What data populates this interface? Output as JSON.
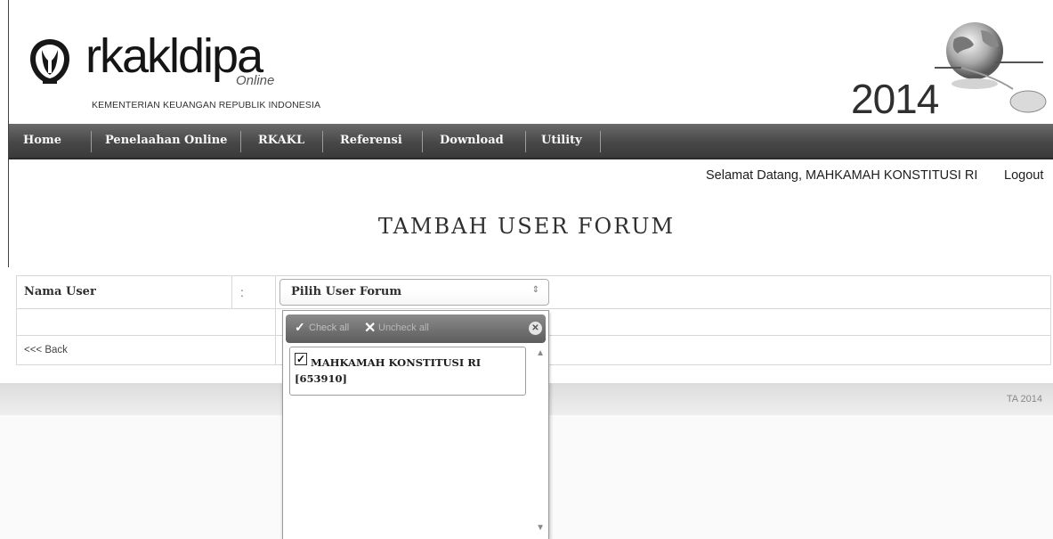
{
  "header": {
    "app_name": "rkakldipa",
    "app_suffix": "Online",
    "organization": "KEMENTERIAN KEUANGAN REPUBLIK INDONESIA",
    "year": "2014"
  },
  "nav": {
    "items": [
      {
        "label": "Home"
      },
      {
        "label": "Penelaahan Online"
      },
      {
        "label": "RKAKL"
      },
      {
        "label": "Referensi"
      },
      {
        "label": "Download"
      },
      {
        "label": "Utility"
      }
    ]
  },
  "user_bar": {
    "welcome": "Selamat Datang, MAHKAMAH KONSTITUSI RI",
    "logout": "Logout"
  },
  "page": {
    "title": "TAMBAH USER FORUM"
  },
  "form": {
    "nama_user_label": "Nama User",
    "separator": ":",
    "back_link": "<<< Back",
    "select": {
      "value": "Pilih User Forum",
      "arrow": "⇕"
    }
  },
  "dropdown": {
    "check_all_icon": "✓",
    "check_all_label": "Check all",
    "uncheck_all_icon": "✕",
    "uncheck_all_label": "Uncheck all",
    "close_icon": "✕",
    "options": [
      {
        "label": "MAHKAMAH KONSTITUSI RI [653910]",
        "checked": true
      }
    ]
  },
  "footer": {
    "text": "TA 2014"
  }
}
